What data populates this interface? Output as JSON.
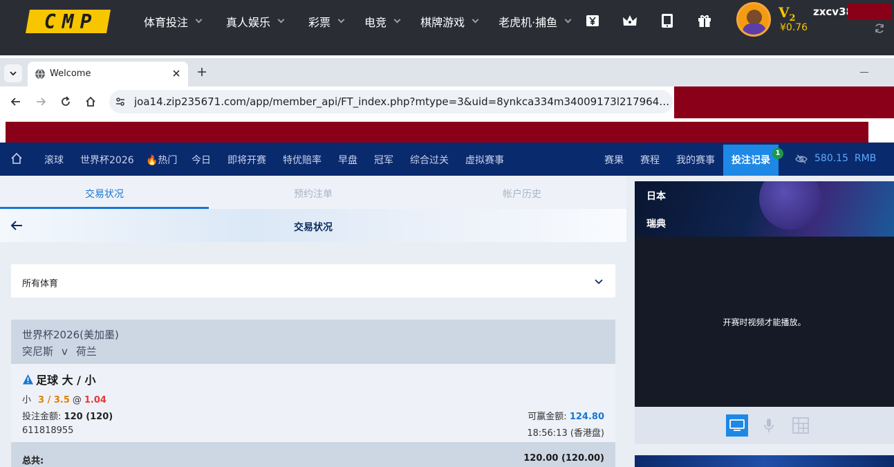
{
  "site": {
    "logo_text": "CMP",
    "nav": [
      "体育投注",
      "真人娱乐",
      "彩票",
      "电竞",
      "棋牌游戏",
      "老虎机·捕鱼"
    ],
    "icons": [
      "yen-icon",
      "crown-icon",
      "tablet-icon",
      "gift-icon"
    ],
    "vip_level": "V",
    "vip_number": "2",
    "balance": "¥0.76",
    "username": "zxcv38"
  },
  "browser": {
    "tab_title": "Welcome",
    "url": "joa14.zip235671.com/app/member_api/FT_index.php?mtype=3&uid=8ynkca334m34009173l2179649&langx=zh-..."
  },
  "sports_nav": {
    "left_items": [
      "滚球",
      "世界杯2026",
      "🔥热门",
      "今日",
      "即将开赛",
      "特优赔率",
      "早盘",
      "冠军",
      "综合过关",
      "虚拟赛事"
    ],
    "right_items": [
      "赛果",
      "赛程",
      "我的赛事"
    ],
    "active_item": "投注记录",
    "badge": "1",
    "balance": "580.15",
    "currency": "RMB"
  },
  "subtabs": [
    "交易状况",
    "预约注单",
    "帐户历史"
  ],
  "page_title": "交易状况",
  "filter": {
    "label": "所有体育"
  },
  "bet": {
    "league": "世界杯2026(美加墨)",
    "home": "突尼斯",
    "vs": "v",
    "away": "荷兰",
    "type": "足球 大 / 小",
    "selection": "小",
    "line": "3 / 3.5",
    "at": "@",
    "odds": "1.04",
    "stake_label": "投注金额:",
    "stake": "120 (120)",
    "win_label": "可赢金额:",
    "win": "124.80",
    "ticket": "611818955",
    "time": "18:56:13 (香港盘)",
    "total_label": "总共:",
    "total": "120.00 (120.00)"
  },
  "video": {
    "team1": "日本",
    "team2": "瑞典",
    "message": "开赛时视频才能播放。"
  },
  "colors": {
    "header_bg": "#2b2d35",
    "logo": "#f7c600",
    "nav_bg": "#0a2a6e",
    "accent": "#1976d2",
    "redaction": "#8b0019",
    "odds_line": "#e67e00",
    "odds": "#e53935"
  }
}
